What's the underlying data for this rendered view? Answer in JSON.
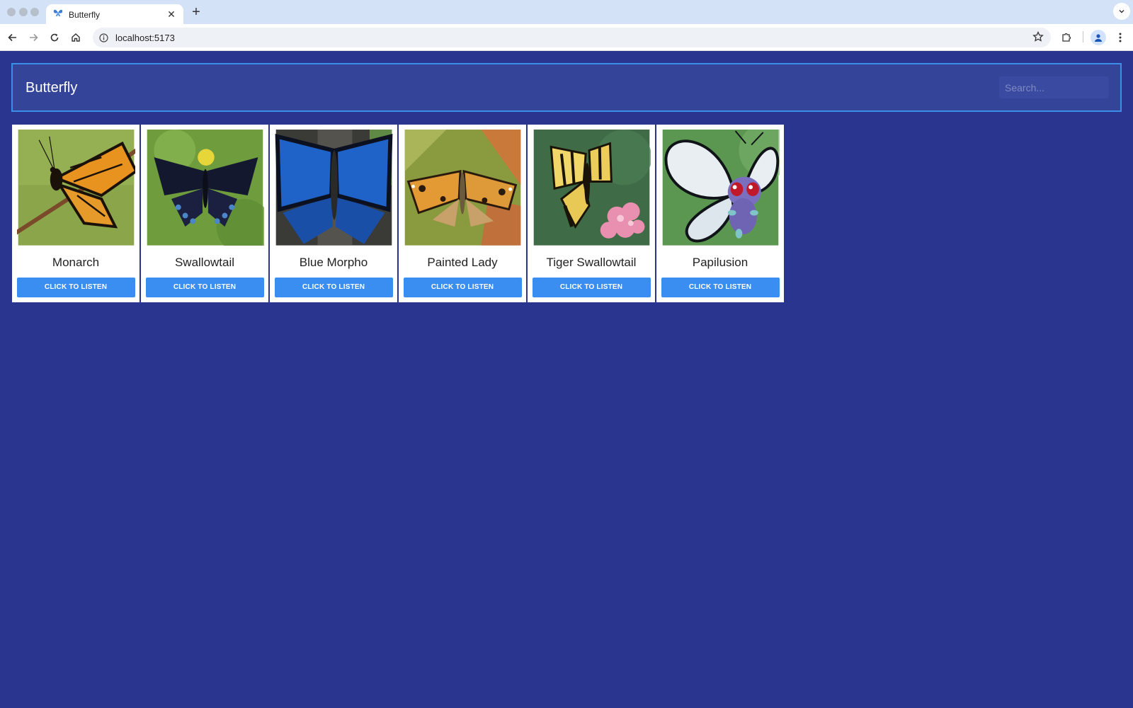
{
  "browser": {
    "tab_title": "Butterfly",
    "url": "localhost:5173"
  },
  "app": {
    "title": "Butterfly",
    "search_placeholder": "Search...",
    "colors": {
      "page_bg": "#29358e",
      "header_bg": "#344498",
      "header_border": "#3b8fe6",
      "button": "#3b8ef1"
    }
  },
  "cards": [
    {
      "name": "Monarch",
      "button": "CLICK TO LISTEN"
    },
    {
      "name": "Swallowtail",
      "button": "CLICK TO LISTEN"
    },
    {
      "name": "Blue Morpho",
      "button": "CLICK TO LISTEN"
    },
    {
      "name": "Painted Lady",
      "button": "CLICK TO LISTEN"
    },
    {
      "name": "Tiger Swallowtail",
      "button": "CLICK TO LISTEN"
    },
    {
      "name": "Papilusion",
      "button": "CLICK TO LISTEN"
    }
  ]
}
